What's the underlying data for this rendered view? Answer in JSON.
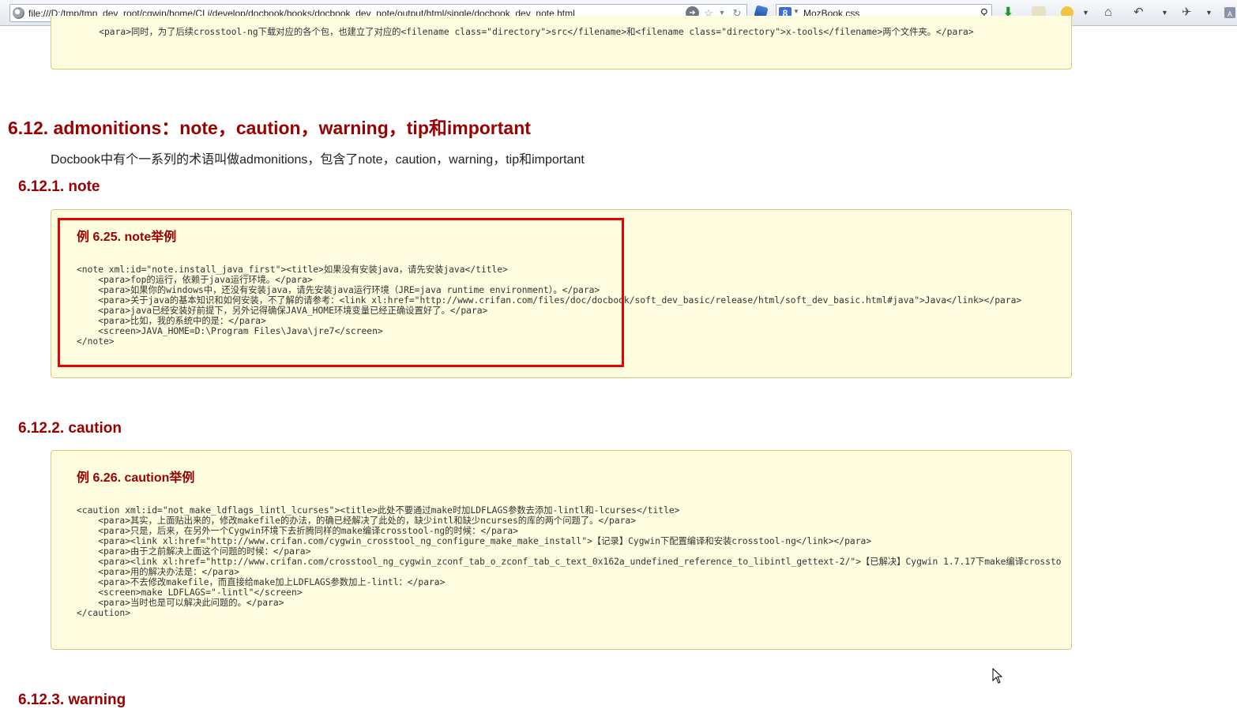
{
  "toolbar": {
    "url": "file:///D:/tmp/tmp_dev_root/cgwin/home/CLi/develop/docbook/books/docbook_dev_note/output/html/single/docbook_dev_note.html",
    "search_text": "MozBook  css",
    "search_engine": "8"
  },
  "page": {
    "prev_code_line": "    <para>同时，为了后续crosstool-ng下载对应的各个包，也建立了对应的<filename class=\"directory\">src</filename>和<filename class=\"directory\">x-tools</filename>两个文件夹。</para>",
    "section_title": "6.12. admonitions：note，caution，warning，tip和important",
    "intro": "Docbook中有个一系列的术语叫做admonitions，包含了note，caution，warning，tip和important",
    "note": {
      "heading": "6.12.1. note",
      "example_title": "例 6.25. note举例",
      "code": [
        "<note xml:id=\"note.install_java_first\"><title>如果没有安装java，请先安装java</title>",
        "    <para>fop的运行，依赖于java运行环境。</para>",
        "    <para>如果你的windows中，还没有安装java，请先安装java运行环境（JRE=java runtime environment）。</para>",
        "    <para>关于java的基本知识和如何安装，不了解的请参考：<link xl:href=\"http://www.crifan.com/files/doc/docbook/soft_dev_basic/release/html/soft_dev_basic.html#java\">Java</link></para>",
        "    <para>java已经安装好前提下，另外记得确保JAVA_HOME环境变量已经正确设置好了。</para>",
        "    <para>比如，我的系统中的是：</para>",
        "    <screen>JAVA_HOME=D:\\Program Files\\Java\\jre7</screen>",
        "</note>"
      ]
    },
    "caution": {
      "heading": "6.12.2. caution",
      "example_title": "例 6.26. caution举例",
      "code": [
        "<caution xml:id=\"not_make_ldflags_lintl_lcurses\"><title>此处不要通过make时加LDFLAGS参数去添加-lintl和-lcurses</title>",
        "    <para>其实，上面贴出来的，修改makefile的办法，的确已经解决了此处的，缺少intl和缺少ncurses的库的两个问题了。</para>",
        "    <para>只是，后来，在另外一个Cygwin环境下去折腾同样的make编译crosstool-ng的时候：</para>",
        "    <para><link xl:href=\"http://www.crifan.com/cygwin_crosstool_ng_configure_make_make_install\">【记录】Cygwin下配置编译和安装crosstool-ng</link></para>",
        "    <para>由于之前解决上面这个问题的时候：</para>",
        "    <para><link xl:href=\"http://www.crifan.com/crosstool_ng_cygwin_zconf_tab_o_zconf_tab_c_text_0x162a_undefined_reference_to_libintl_gettext-2/\">【已解决】Cygwin 1.7.17下make编译crossto",
        "    <para>用的解决办法是：</para>",
        "    <para>不去修改makefile，而直接给make加上LDFLAGS参数加上-lintl：</para>",
        "    <screen>make LDFLAGS=\"-lintl\"</screen>",
        "    <para>当时也是可以解决此问题的。</para>",
        "</caution>"
      ]
    },
    "warning": {
      "heading": "6.12.3. warning"
    }
  }
}
